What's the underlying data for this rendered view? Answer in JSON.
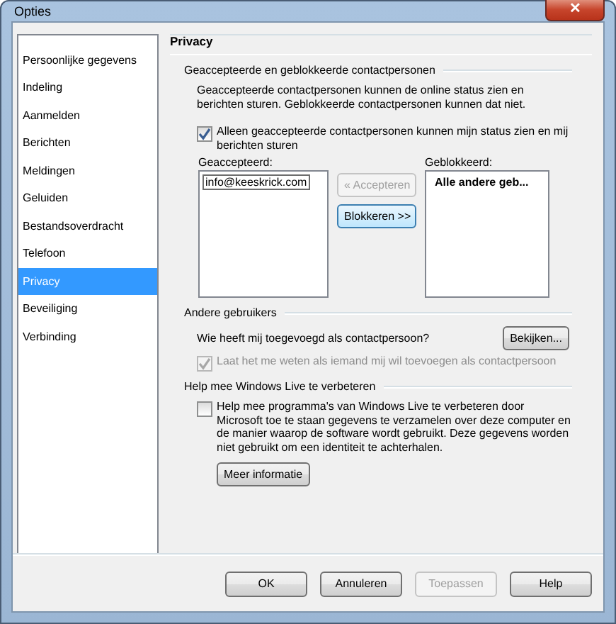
{
  "window": {
    "title": "Opties",
    "close": "✕"
  },
  "sidebar": {
    "items": [
      {
        "label": "Persoonlijke gegevens",
        "selected": false
      },
      {
        "label": "Indeling",
        "selected": false
      },
      {
        "label": "Aanmelden",
        "selected": false
      },
      {
        "label": "Berichten",
        "selected": false
      },
      {
        "label": "Meldingen",
        "selected": false
      },
      {
        "label": "Geluiden",
        "selected": false
      },
      {
        "label": "Bestandsoverdracht",
        "selected": false
      },
      {
        "label": "Telefoon",
        "selected": false
      },
      {
        "label": "Privacy",
        "selected": true
      },
      {
        "label": "Beveiliging",
        "selected": false
      },
      {
        "label": "Verbinding",
        "selected": false
      }
    ]
  },
  "page_title": "Privacy",
  "contacts": {
    "heading": "Geaccepteerde en geblokkeerde contactpersonen",
    "description": "Geaccepteerde contactpersonen kunnen de online status zien en berichten sturen. Geblokkeerde contactpersonen kunnen dat niet.",
    "only_accepted": {
      "label": "Alleen geaccepteerde contactpersonen kunnen mijn status zien en mij berichten sturen",
      "checked": true,
      "disabled": false
    },
    "accepted_label": "Geaccepteerd:",
    "accepted_items": [
      "info@keeskrick.com"
    ],
    "blocked_label": "Geblokkeerd:",
    "blocked_items": [
      "Alle andere geb..."
    ],
    "buttons": [
      {
        "label": "« Accepteren",
        "disabled": true
      },
      {
        "label": "Blokkeren >>",
        "disabled": false
      }
    ]
  },
  "others": {
    "heading": "Andere gebruikers",
    "question": "Wie heeft mij toegevoegd als contactpersoon?",
    "view_button": "Bekijken...",
    "notify": {
      "label": "Laat het me weten als iemand mij wil toevoegen als contactpersoon",
      "checked": true,
      "disabled": true
    }
  },
  "improve": {
    "heading": "Help mee Windows Live te verbeteren",
    "help": {
      "label": "Help mee programma's van Windows Live te verbeteren door Microsoft toe te staan gegevens te verzamelen over deze computer en de manier waarop de software wordt gebruikt. Deze gegevens worden niet gebruikt om een identiteit te achterhalen.",
      "checked": false,
      "disabled": false
    },
    "more_button": "Meer informatie"
  },
  "footer": [
    {
      "label": "OK",
      "disabled": false
    },
    {
      "label": "Annuleren",
      "disabled": false
    },
    {
      "label": "Toepassen",
      "disabled": true
    },
    {
      "label": "Help",
      "disabled": false
    }
  ]
}
